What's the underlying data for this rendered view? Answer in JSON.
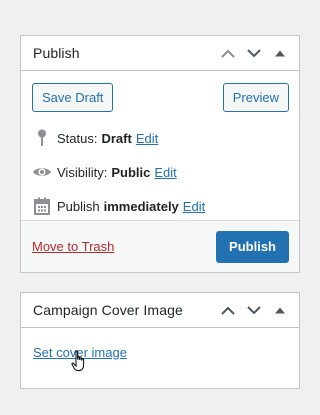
{
  "publish_box": {
    "title": "Publish",
    "controls": {
      "move_up": "chevron-up-icon",
      "move_down": "chevron-down-icon",
      "toggle": "triangle-up-icon"
    },
    "save_draft_label": "Save Draft",
    "preview_label": "Preview",
    "status": {
      "icon": "pin-icon",
      "label": "Status:",
      "value": "Draft",
      "edit_label": "Edit"
    },
    "visibility": {
      "icon": "eye-icon",
      "label": "Visibility:",
      "value": "Public",
      "edit_label": "Edit"
    },
    "schedule": {
      "icon": "calendar-icon",
      "label": "Publish",
      "value": "immediately",
      "edit_label": "Edit"
    },
    "trash_label": "Move to Trash",
    "publish_label": "Publish"
  },
  "cover_box": {
    "title": "Campaign Cover Image",
    "controls": {
      "move_up": "chevron-up-icon",
      "move_down": "chevron-down-icon",
      "toggle": "triangle-up-icon"
    },
    "set_cover_label": "Set cover image"
  },
  "cursor": "hand-pointer-icon",
  "colors": {
    "accent": "#2271b1",
    "danger": "#b32d2e",
    "border": "#c3c4c7",
    "background": "#f0f0f1",
    "footer_background": "#f6f7f7",
    "icon_gray": "#8c8f94"
  }
}
